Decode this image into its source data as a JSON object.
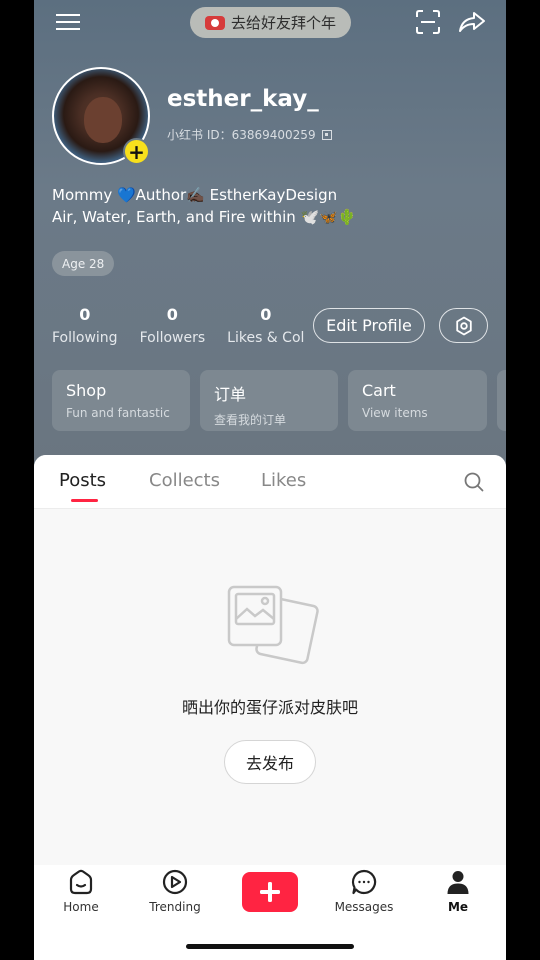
{
  "topbar": {
    "greeting": "去给好友拜个年"
  },
  "profile": {
    "username": "esther_kay_",
    "id_label": "小红书 ID：63869400259",
    "bio_line1": "Mommy 💙Author✍🏿 EstherKayDesign",
    "bio_line2": "Air, Water, Earth, and Fire within 🕊️🦋🌵",
    "age": "Age 28"
  },
  "stats": [
    {
      "value": "0",
      "label": "Following"
    },
    {
      "value": "0",
      "label": "Followers"
    },
    {
      "value": "0",
      "label": "Likes & Col"
    }
  ],
  "buttons": {
    "edit_profile": "Edit Profile"
  },
  "cards": [
    {
      "title": "Shop",
      "subtitle": "Fun and fantastic"
    },
    {
      "title": "订单",
      "subtitle": "查看我的订单"
    },
    {
      "title": "Cart",
      "subtitle": "View items"
    }
  ],
  "tabs": [
    {
      "label": "Posts"
    },
    {
      "label": "Collects"
    },
    {
      "label": "Likes"
    }
  ],
  "empty_state": {
    "message": "晒出你的蛋仔派对皮肤吧",
    "button": "去发布"
  },
  "bottom_nav": [
    {
      "label": "Home",
      "icon": "home-icon"
    },
    {
      "label": "Trending",
      "icon": "play-icon"
    },
    {
      "label": "Messages",
      "icon": "message-icon"
    },
    {
      "label": "Me",
      "icon": "person-icon"
    }
  ],
  "colors": {
    "accent": "#ff2442",
    "plus_badge": "#f8e01c"
  }
}
